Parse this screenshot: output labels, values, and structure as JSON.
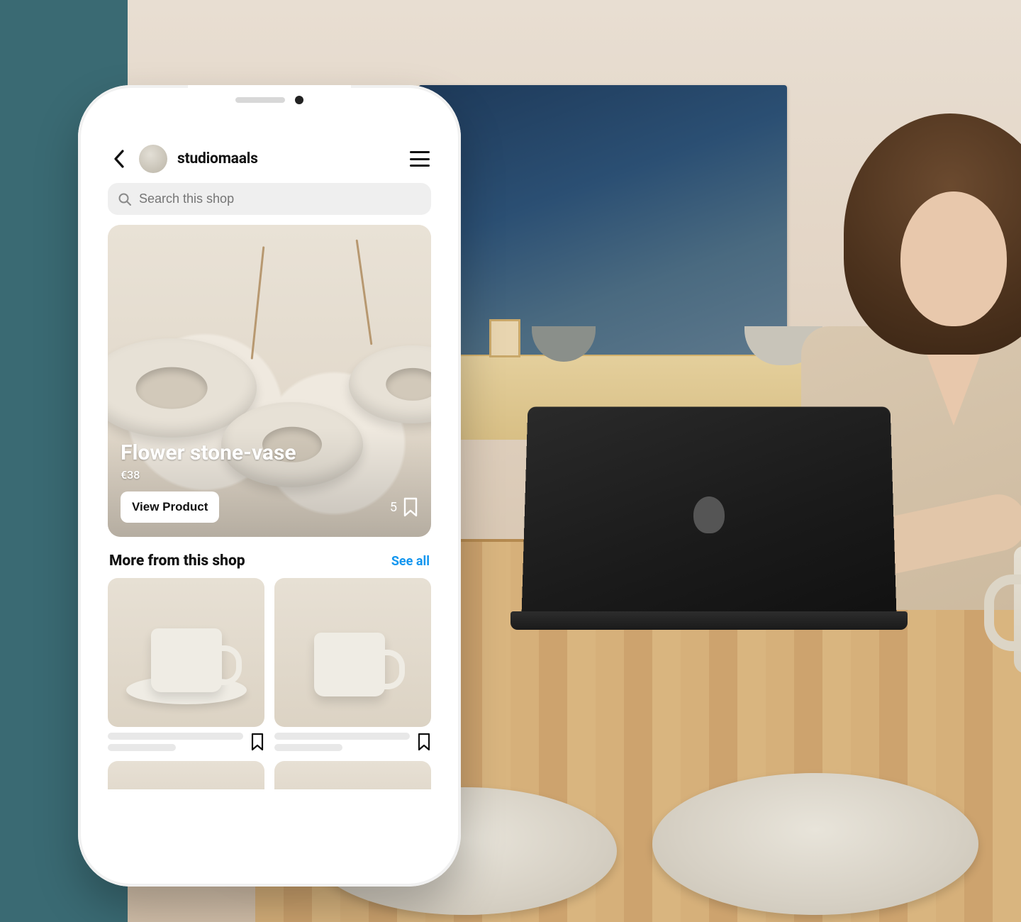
{
  "header": {
    "shop_name": "studiomaals",
    "back_icon": "chevron-left-icon",
    "menu_icon": "menu-icon",
    "avatar_icon": "avatar"
  },
  "search": {
    "placeholder": "Search this shop",
    "icon": "search-icon"
  },
  "hero": {
    "title": "Flower stone-vase",
    "price": "€38",
    "view_button": "View Product",
    "save_count": "5",
    "bookmark_icon": "bookmark-icon"
  },
  "more_section": {
    "label": "More from this shop",
    "see_all": "See all"
  },
  "tiles": [
    {
      "bookmark_icon": "bookmark-icon"
    },
    {
      "bookmark_icon": "bookmark-icon"
    }
  ],
  "colors": {
    "accent_link": "#1396ef",
    "teal_band": "#3a6a73"
  }
}
